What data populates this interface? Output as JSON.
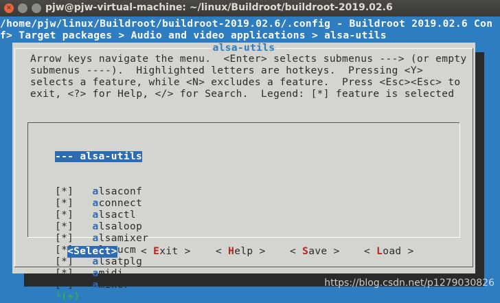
{
  "window": {
    "title": "pjw@pjw-virtual-machine: ~/linux/Buildroot/buildroot-2019.02.6"
  },
  "header": {
    "line1": "/home/pjw/linux/Buildroot/buildroot-2019.02.6/.config - Buildroot 2019.02.6 Con",
    "line2": "f> Target packages > Audio and video applications > alsa-utils"
  },
  "dialog": {
    "title": "alsa-utils",
    "help": "Arrow keys navigate the menu.  <Enter> selects submenus ---> (or empty\nsubmenus ----).  Highlighted letters are hotkeys.  Pressing <Y>\nselects a feature, while <N> excludes a feature.  Press <Esc><Esc> to\nexit, <?> for Help, </> for Search.  Legend: [*] feature is selected"
  },
  "menu": {
    "header_item": "--- alsa-utils",
    "items": [
      {
        "mark": "[*]",
        "hot": "a",
        "rest": "lsaconf"
      },
      {
        "mark": "[*]",
        "hot": "a",
        "rest": "connect"
      },
      {
        "mark": "[*]",
        "hot": "a",
        "rest": "lsactl"
      },
      {
        "mark": "[*]",
        "hot": "a",
        "rest": "lsaloop"
      },
      {
        "mark": "[*]",
        "hot": "a",
        "rest": "lsamixer"
      },
      {
        "mark": "[*]",
        "hot": "a",
        "rest": "lsaucm"
      },
      {
        "mark": "[*]",
        "hot": "a",
        "rest": "lsatplg"
      },
      {
        "mark": "[*]",
        "hot": "a",
        "rest": "midi"
      },
      {
        "mark": "[*]",
        "hot": "a",
        "rest": "mixer"
      }
    ],
    "more_indicator": "└(+)"
  },
  "buttons": [
    {
      "pre": "<",
      "hot": "S",
      "post": "elect>"
    },
    {
      "pre": "< ",
      "hot": "E",
      "post": "xit >"
    },
    {
      "pre": "< ",
      "hot": "H",
      "post": "elp >"
    },
    {
      "pre": "< ",
      "hot": "S",
      "post": "ave >"
    },
    {
      "pre": "< ",
      "hot": "L",
      "post": "oad >"
    }
  ],
  "watermark": "https://blog.csdn.net/p1279030826",
  "colors": {
    "terminal_bg": "#2d7dc0",
    "dialog_bg": "#d4d4d0",
    "highlight": "#2d6bb3",
    "hotkey": "#b3261e",
    "more": "#2fb04a"
  }
}
